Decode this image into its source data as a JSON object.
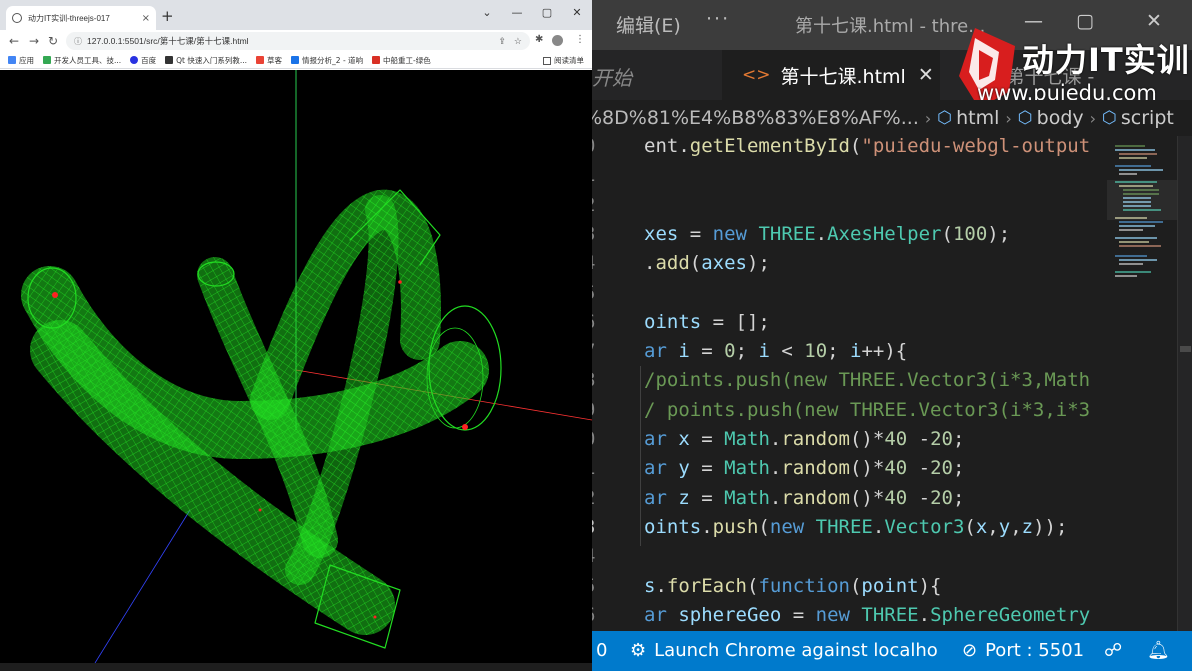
{
  "browser": {
    "tab_title": "动力IT实训-threejs-017",
    "close_label": "×",
    "new_tab_label": "+",
    "url": "127.0.0.1:5501/src/第十七课/第十七课.html",
    "bookmarks": [
      {
        "label": "应用",
        "color": "#4285f4"
      },
      {
        "label": "开发人员工具、技...",
        "color": "#34a853"
      },
      {
        "label": "百度",
        "color": "#2932e1"
      },
      {
        "label": "Qt 快速入门系列教...",
        "color": "#41cd52"
      },
      {
        "label": "草客",
        "color": "#ea4335"
      },
      {
        "label": "情报分析_2 - 道响",
        "color": "#1a73e8"
      },
      {
        "label": "中船重工-绿色",
        "color": "#d93025"
      }
    ],
    "reading_list": "阅读清单"
  },
  "scene": {
    "wire_color": "#22dd22",
    "axis_x_color": "#ff3333",
    "axis_y_color": "#33ff66",
    "axis_z_color": "#3344ff",
    "point_color": "#ff2222"
  },
  "editor": {
    "menu_edit": "编辑(E)",
    "menu_more": "···",
    "window_title": "第十七课.html - thre...",
    "logo_brand": "动力IT实训",
    "logo_site": "www.puiedu.com",
    "start_tab": "开始",
    "active_tab": "第十七课.html",
    "second_tab": "第十七课 - ",
    "breadcrumb_path": "%8D%81%E4%B8%83%E8%AF%...",
    "breadcrumb_items": [
      "html",
      "body",
      "script"
    ],
    "lines": [
      {
        "num": "0",
        "html": "ent.<span class='f'>getElementById</span>(<span class='s'>\"puiedu-webgl-output</span>"
      },
      {
        "num": "1",
        "html": ""
      },
      {
        "num": "2",
        "html": ""
      },
      {
        "num": "3",
        "html": "<span class='v'>xes</span> = <span class='k'>new</span> <span class='t'>THREE</span>.<span class='t'>AxesHelper</span>(<span class='n'>100</span>);"
      },
      {
        "num": "4",
        "html": ".<span class='f'>add</span>(<span class='v'>axes</span>);"
      },
      {
        "num": "5",
        "html": ""
      },
      {
        "num": "6",
        "html": "<span class='v'>oints</span> = [];"
      },
      {
        "num": "7",
        "html": "<span class='k'>ar</span> <span class='v'>i</span> = <span class='n'>0</span>; <span class='v'>i</span> &lt; <span class='n'>10</span>; <span class='v'>i</span>++){"
      },
      {
        "num": "8",
        "html": "<span class='c'>/points.push(new THREE.Vector3(i*3,Math</span>"
      },
      {
        "num": "9",
        "html": "<span class='c'>/ points.push(new THREE.Vector3(i*3,i*3</span>"
      },
      {
        "num": "0",
        "html": "<span class='k'>ar</span> <span class='v'>x</span> = <span class='t'>Math</span>.<span class='f'>random</span>()*<span class='n'>40</span> -<span class='n'>20</span>;"
      },
      {
        "num": "1",
        "html": "<span class='k'>ar</span> <span class='v'>y</span> = <span class='t'>Math</span>.<span class='f'>random</span>()*<span class='n'>40</span> -<span class='n'>20</span>;"
      },
      {
        "num": "2",
        "html": "<span class='k'>ar</span> <span class='v'>z</span> = <span class='t'>Math</span>.<span class='f'>random</span>()*<span class='n'>40</span> -<span class='n'>20</span>;"
      },
      {
        "num": "3",
        "html": "<span class='v'>oints</span>.<span class='f'>push</span>(<span class='k'>new</span> <span class='t'>THREE</span>.<span class='t'>Vector3</span>(<span class='v'>x</span>,<span class='v'>y</span>,<span class='v'>z</span>));",
        "active": true
      },
      {
        "num": "4",
        "html": ""
      },
      {
        "num": "5",
        "html": "<span class='v'>s</span>.<span class='f'>forEach</span>(<span class='k'>function</span>(<span class='v'>point</span>){"
      },
      {
        "num": "6",
        "html": "<span class='k'>ar</span> <span class='v'>sphereGeo</span> = <span class='k'>new</span> <span class='t'>THREE</span>.<span class='t'>SphereGeometry</span>"
      }
    ],
    "status": {
      "left_num": "0",
      "launch": "Launch Chrome against localho",
      "port": "Port : 5501"
    }
  }
}
